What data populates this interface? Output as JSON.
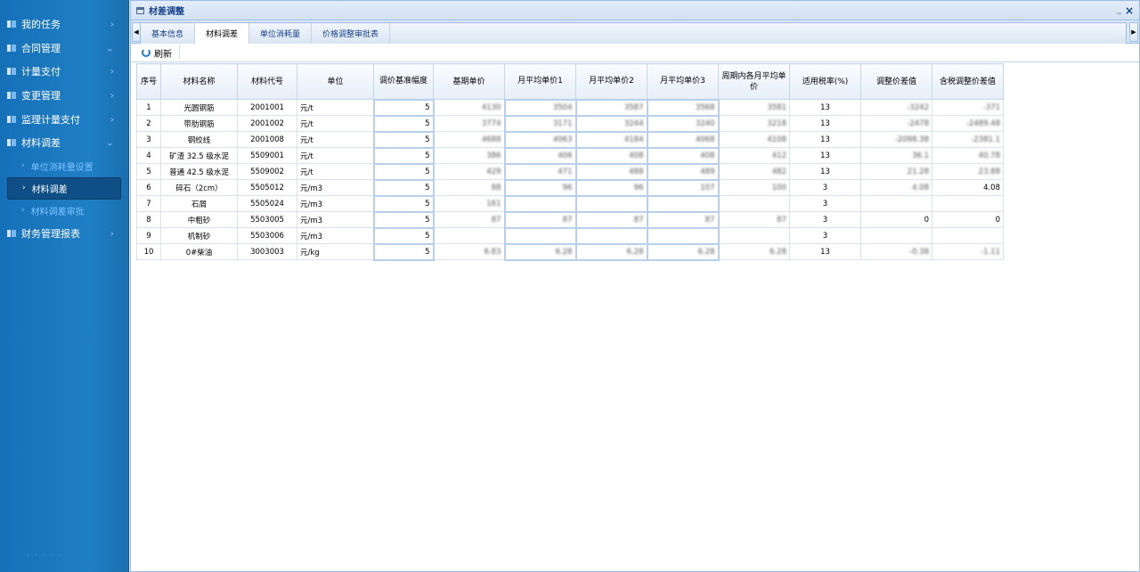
{
  "sidebar": {
    "items": [
      {
        "label": "我的任务",
        "chev": "›"
      },
      {
        "label": "合同管理",
        "chev": "⌄"
      },
      {
        "label": "计量支付",
        "chev": "›"
      },
      {
        "label": "变更管理",
        "chev": "›"
      },
      {
        "label": "监理计量支付",
        "chev": "›"
      },
      {
        "label": "材料调差",
        "chev": "⌄"
      }
    ],
    "sub_items": [
      {
        "label": "单位消耗量设置",
        "dot": "›"
      },
      {
        "label": "材料调差",
        "dot": "›"
      },
      {
        "label": "材料调差审批",
        "dot": "›"
      }
    ],
    "last_item": {
      "label": "财务管理报表",
      "chev": "›"
    }
  },
  "window": {
    "title": "材差调整",
    "close": "×",
    "minimize": "_"
  },
  "tabs": [
    "基本信息",
    "材料调差",
    "单位消耗量",
    "价格调整审批表"
  ],
  "active_tab": 1,
  "toolbar": {
    "refresh_label": "刷新"
  },
  "grid": {
    "columns": [
      "序号",
      "材料名称",
      "材料代号",
      "单位",
      "调价基准幅度",
      "基期单价",
      "月平均单价1",
      "月平均单价2",
      "月平均单价3",
      "周期内各月平均单价",
      "适用税率(%)",
      "调整价差值",
      "含税调整价差值"
    ],
    "rows": [
      [
        "1",
        "光圆钢筋",
        "2001001",
        "元/t",
        "5",
        "4130",
        "3504",
        "3587",
        "3568",
        "3581",
        "13",
        "-3242",
        "-371"
      ],
      [
        "2",
        "带肋钢筋",
        "2001002",
        "元/t",
        "5",
        "3774",
        "3171",
        "3244",
        "3240",
        "3218",
        "13",
        "-2478",
        "-2489.48"
      ],
      [
        "3",
        "钢绞线",
        "2001008",
        "元/t",
        "5",
        "4688",
        "4063",
        "4184",
        "4068",
        "4108",
        "13",
        "-2098.38",
        "-2381.1"
      ],
      [
        "4",
        "矿渣 32.5 级水泥",
        "5509001",
        "元/t",
        "5",
        "386",
        "406",
        "408",
        "408",
        "412",
        "13",
        "36.1",
        "40.78"
      ],
      [
        "5",
        "普通 42.5 级水泥",
        "5509002",
        "元/t",
        "5",
        "429",
        "471",
        "488",
        "489",
        "482",
        "13",
        "21.28",
        "23.88"
      ],
      [
        "6",
        "碎石（2cm）",
        "5505012",
        "元/m3",
        "5",
        "88",
        "96",
        "96",
        "107",
        "100",
        "3",
        "4.08",
        "4.08"
      ],
      [
        "7",
        "石屑",
        "5505024",
        "元/m3",
        "5",
        "161",
        "",
        "",
        "",
        "",
        "3",
        "",
        ""
      ],
      [
        "8",
        "中粗砂",
        "5503005",
        "元/m3",
        "5",
        "87",
        "87",
        "87",
        "87",
        "87",
        "3",
        "0",
        "0"
      ],
      [
        "9",
        "机制砂",
        "5503006",
        "元/m3",
        "5",
        "",
        "",
        "",
        "",
        "",
        "3",
        "",
        ""
      ],
      [
        "10",
        "0#柴油",
        "3003003",
        "元/kg",
        "5",
        "6.83",
        "6.28",
        "6.28",
        "6.28",
        "6.28",
        "13",
        "-0.38",
        "-1.11"
      ]
    ]
  },
  "footer_mark": "· · · · ·"
}
